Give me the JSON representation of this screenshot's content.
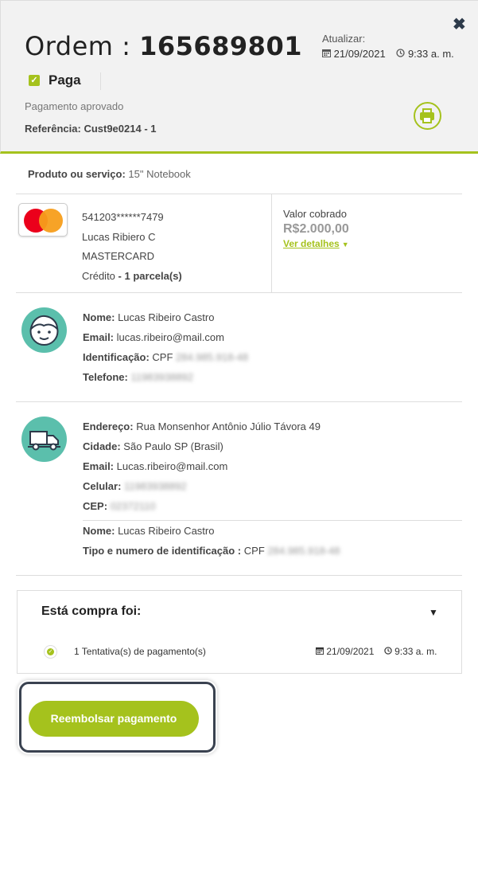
{
  "header": {
    "order_label": "Ordem :",
    "order_number": "165689801",
    "update_label": "Atualizar:",
    "update_date": "21/09/2021",
    "update_time": "9:33 a. m.",
    "status_label": "Paga",
    "status_text": "Pagamento aprovado",
    "reference_label": "Referência:",
    "reference_value": "Cust9e0214 - 1"
  },
  "product": {
    "label": "Produto ou serviço:",
    "value": "15\" Notebook"
  },
  "payment": {
    "card_number": "541203******7479",
    "holder": "Lucas Ribiero C",
    "brand": "MASTERCARD",
    "type_label": "Crédito",
    "installments": "1 parcela(s)",
    "charge_label": "Valor cobrado",
    "charge_value": "R$2.000,00",
    "details_link": "Ver detalhes"
  },
  "customer": {
    "name_label": "Nome:",
    "name": "Lucas Ribeiro Castro",
    "email_label": "Email:",
    "email": "lucas.ribeiro@mail.com",
    "id_label": "Identificação:",
    "id_type": "CPF",
    "id_value": "284.985.918-48",
    "phone_label": "Telefone:",
    "phone": "11983938892"
  },
  "shipping": {
    "address_label": "Endereço:",
    "address": "Rua Monsenhor Antônio Júlio Távora 49",
    "city_label": "Cidade:",
    "city": "São Paulo SP (Brasil)",
    "email_label": "Email:",
    "email": "Lucas.ribeiro@mail.com",
    "mobile_label": "Celular:",
    "mobile": "11983938892",
    "zip_label": "CEP:",
    "zip": "02372110",
    "recipient_label": "Nome:",
    "recipient": "Lucas Ribeiro Castro",
    "doc_label": "Tipo e numero de identificação :",
    "doc_type": "CPF",
    "doc_value": "284.985.918-48"
  },
  "summary": {
    "title": "Está compra foi:",
    "attempts": "1 Tentativa(s) de pagamento(s)",
    "date": "21/09/2021",
    "time": "9:33 a. m."
  },
  "actions": {
    "refund_label": "Reembolsar pagamento"
  },
  "colors": {
    "accent": "#a5c21d",
    "avatar": "#5bbfac"
  }
}
